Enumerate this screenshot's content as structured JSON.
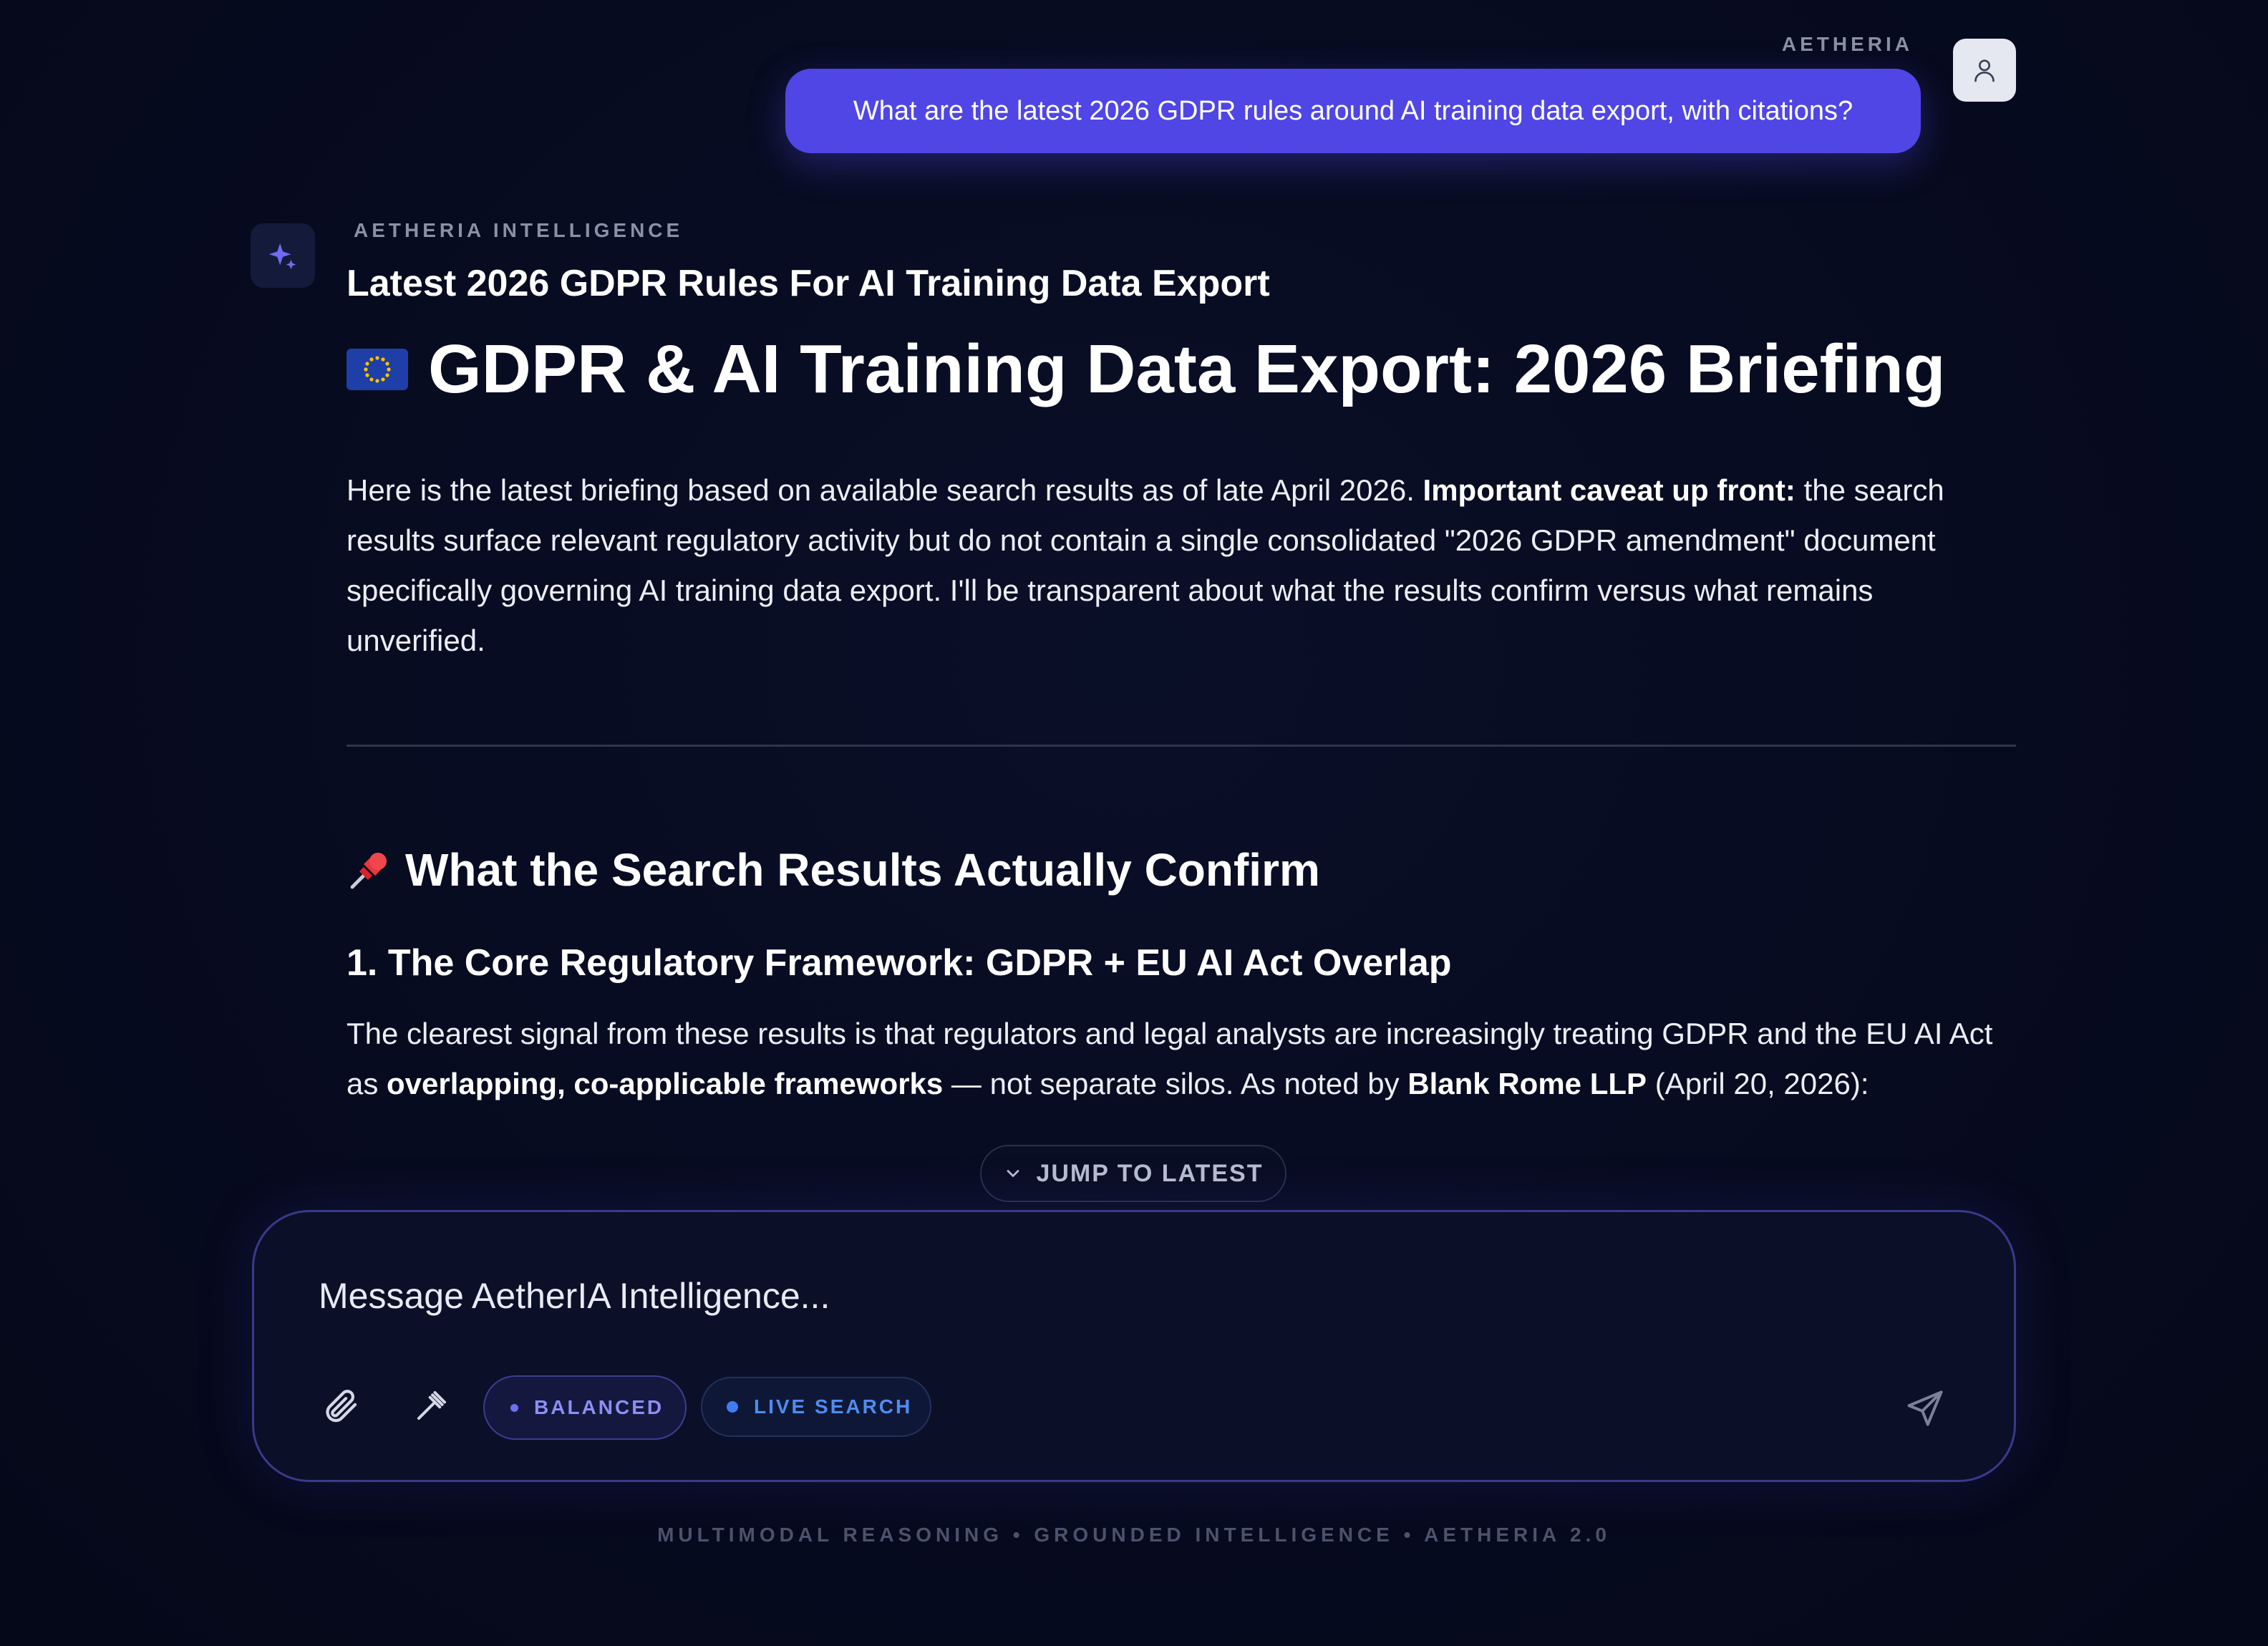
{
  "user": {
    "label": "AETHERIA",
    "message": "What are the latest 2026 GDPR rules around AI training data export, with citations?"
  },
  "assistant": {
    "label": "AETHERIA INTELLIGENCE",
    "subtitle": "Latest 2026 GDPR Rules For AI Training Data Export",
    "title": "GDPR & AI Training Data Export: 2026 Briefing",
    "intro": {
      "text1": "Here is the latest briefing based on available search results as of late April 2026. ",
      "bold1": "Important caveat up front:",
      "text2": " the search results surface relevant regulatory activity but do not contain a single consolidated \"2026 GDPR amendment\" document specifically governing AI training data export. I'll be transparent about what the results confirm versus what remains unverified."
    },
    "section_heading": "What the Search Results Actually Confirm",
    "subsection_heading": "1. The Core Regulatory Framework: GDPR + EU AI Act Overlap",
    "para": {
      "text1": "The clearest signal from these results is that regulators and legal analysts are increasingly treating GDPR and the EU AI Act as ",
      "bold1": "overlapping, co-applicable frameworks",
      "text2": " — not separate silos. As noted by ",
      "bold2": "Blank Rome LLP",
      "text3": " (April 20, 2026):"
    }
  },
  "jump_label": "JUMP TO LATEST",
  "composer": {
    "placeholder": "Message AetherIA Intelligence...",
    "mode_pill": "BALANCED",
    "search_pill": "LIVE SEARCH"
  },
  "footer": "MULTIMODAL REASONING • GROUNDED INTELLIGENCE • AETHERIA 2.0",
  "colors": {
    "accent": "#5046e5",
    "background": "#060a1e",
    "live_search": "#4f8cf2"
  },
  "icons": [
    "user-icon",
    "sparkle-icon",
    "eu-flag-icon",
    "pushpin-icon",
    "chevron-down-icon",
    "paperclip-icon",
    "gavel-icon",
    "send-icon"
  ]
}
